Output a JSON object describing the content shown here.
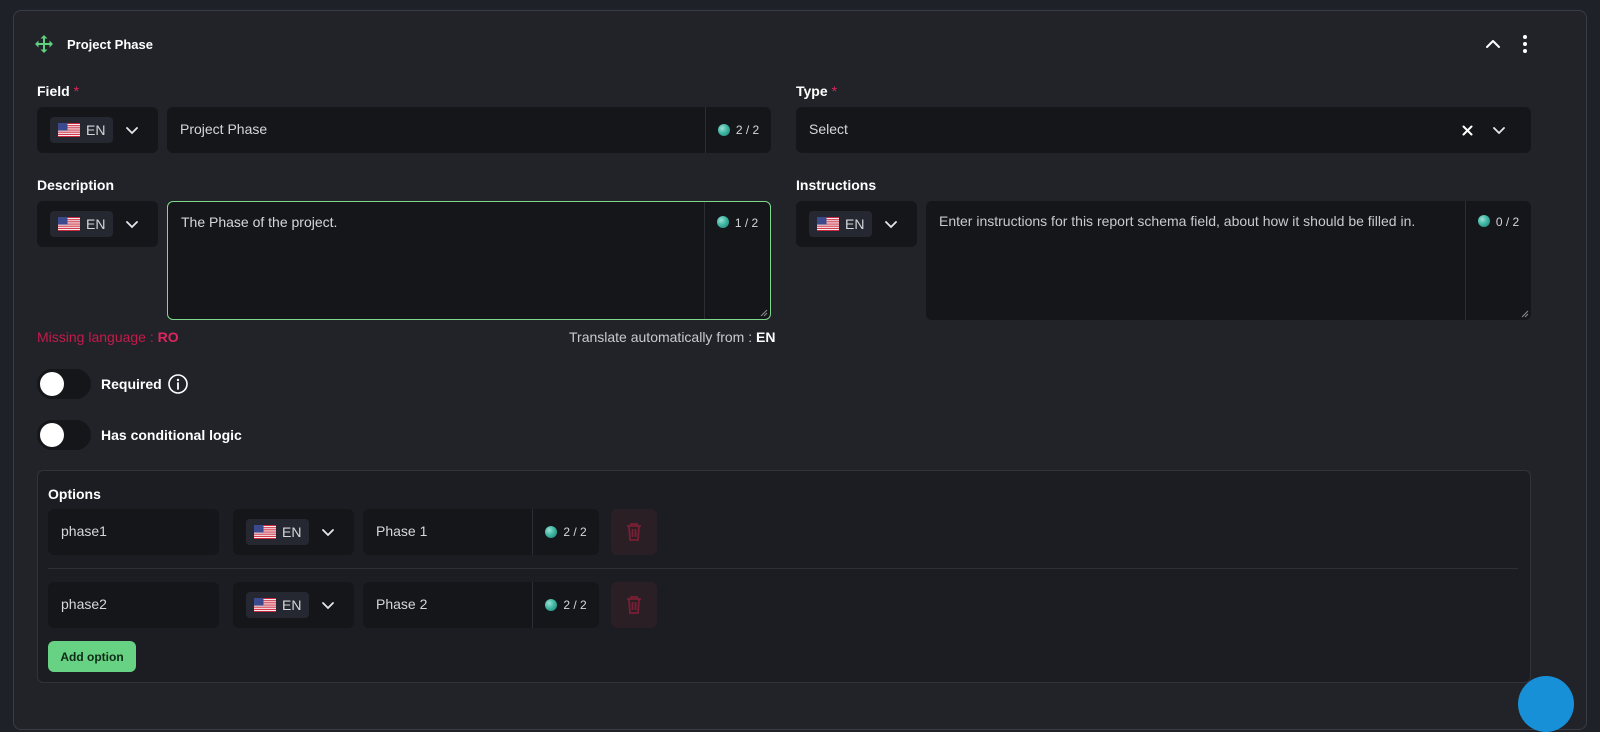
{
  "header": {
    "title": "Project Phase",
    "move_icon": "move-arrows-icon",
    "collapse_icon": "chevron-up-icon",
    "menu_icon": "kebab-menu-icon"
  },
  "field": {
    "label": "Field",
    "required_mark": "*",
    "lang": "EN",
    "value": "Project Phase",
    "count": "2 / 2"
  },
  "type": {
    "label": "Type",
    "required_mark": "*",
    "value": "Select",
    "clear_icon": "close-icon",
    "dropdown_icon": "chevron-down-icon"
  },
  "description": {
    "label": "Description",
    "lang": "EN",
    "value": "The Phase of the project.",
    "count": "1 / 2",
    "missing_prefix": "Missing language : ",
    "missing_lang": "RO",
    "translate_prefix": "Translate automatically from : ",
    "translate_lang": "EN"
  },
  "instructions": {
    "label": "Instructions",
    "lang": "EN",
    "placeholder": "Enter instructions for this report schema field, about how it should be filled in.",
    "count": "0 / 2"
  },
  "toggles": {
    "required_label": "Required",
    "conditional_label": "Has conditional logic"
  },
  "options": {
    "title": "Options",
    "items": [
      {
        "key": "phase1",
        "lang": "EN",
        "label": "Phase 1",
        "count": "2 / 2"
      },
      {
        "key": "phase2",
        "lang": "EN",
        "label": "Phase 2",
        "count": "2 / 2"
      }
    ],
    "add_label": "Add option"
  },
  "colors": {
    "accent_green": "#67d283",
    "error_red": "#e0245e",
    "bg": "#1f2128",
    "field_bg": "#14161a"
  }
}
